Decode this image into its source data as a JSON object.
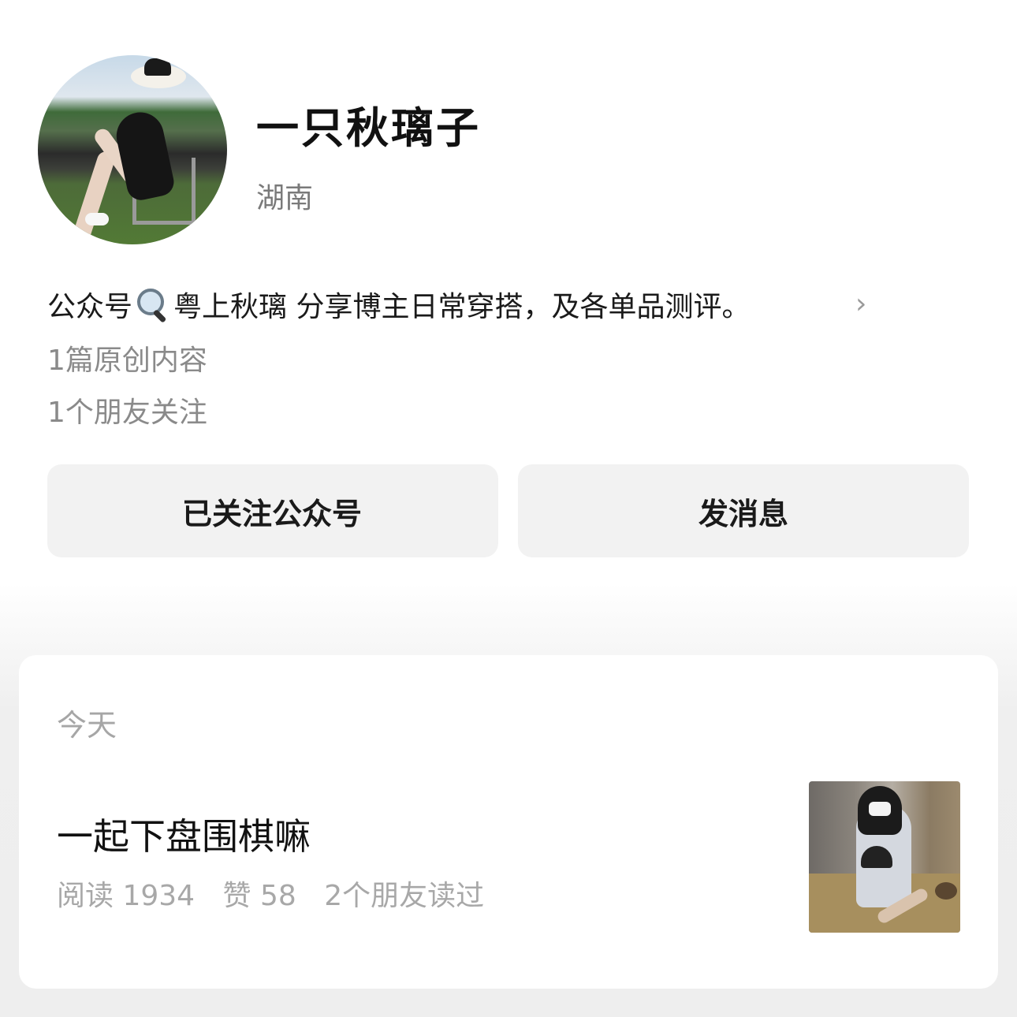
{
  "profile": {
    "name": "一只秋璃子",
    "region": "湖南",
    "intro_prefix": "公众号",
    "intro_suffix": "粤上秋璃 分享博主日常穿搭，及各单品测评。",
    "original_count": "1篇原创内容",
    "friends_following": "1个朋友关注"
  },
  "actions": {
    "follow_label": "已关注公众号",
    "message_label": "发消息"
  },
  "feed": {
    "day_label": "今天",
    "article": {
      "title": "一起下盘围棋嘛",
      "reads": "阅读 1934",
      "likes": "赞 58",
      "friends_read": "2个朋友读过"
    }
  },
  "icons": {
    "intro_glass": "magnifying-glass-icon",
    "chevron": "chevron-right-icon"
  }
}
